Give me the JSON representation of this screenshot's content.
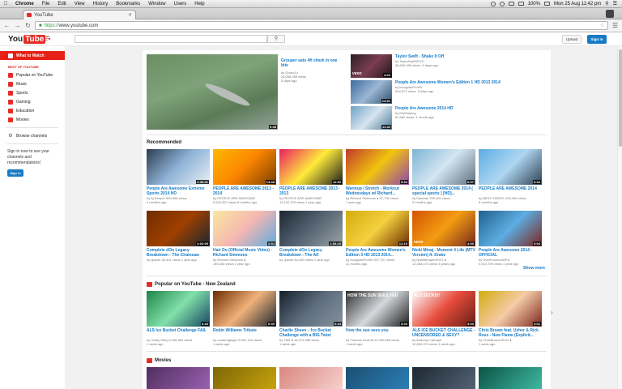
{
  "menubar": {
    "items": [
      "Chrome",
      "File",
      "Edit",
      "View",
      "History",
      "Bookmarks",
      "Window",
      "Users",
      "Help"
    ],
    "battery": "100%",
    "datetime": "Mon 25 Aug 11:42 pm"
  },
  "browser": {
    "tab_title": "YouTube",
    "url_scheme": "https://",
    "url_rest": "www.youtube.com"
  },
  "masthead": {
    "logo_you": "You",
    "logo_tube": "Tube",
    "logo_country": "NZ",
    "upload_label": "Upload",
    "signin_label": "Sign in"
  },
  "sidebar": {
    "what_to_watch": "What to Watch",
    "section_label": "BEST OF YOUTUBE",
    "items": [
      "Popular on YouTube",
      "Music",
      "Sports",
      "Gaming",
      "Education",
      "Movies"
    ],
    "browse_channels": "Browse channels",
    "signin_note": "Sign in now to see your channels and recommendations!",
    "signin_label": "Sign in"
  },
  "featured": {
    "main": {
      "title": "Grouper eats 4ft shark in one bite",
      "channel": "by Gordo14",
      "views": "26,058,998 views",
      "age": "5 days ago",
      "duration": "0:48"
    },
    "side": [
      {
        "title": "Taylor Swift - Shake It Off",
        "channel": "by TaylorSwiftVEVO",
        "views": "36,992,999 views",
        "age": "6 days ago",
        "duration": "4:02",
        "vevo": "vevo"
      },
      {
        "title": "People Are Awesome Women's Edition 1 HD 2013 2014",
        "channel": "by incognitoProHD",
        "views": "544,572 views",
        "age": "5 days ago",
        "duration": "14:51",
        "vevo": ""
      },
      {
        "title": "People Are Awesome 2014 HD",
        "channel": "by DistSniping",
        "views": "62,562 views",
        "age": "1 month ago",
        "duration": "11:42",
        "vevo": ""
      }
    ]
  },
  "recommended": {
    "heading": "Recommended",
    "show_more": "Show more",
    "row1": [
      {
        "title": "People Are Awesome Extreme Sports 2014 HD",
        "meta": "by Aj Deeper  390,058 views",
        "age": "4 months ago",
        "duration": "1:30:01"
      },
      {
        "title": "PEOPLE ARE AWESOME 2013 - 2014",
        "meta": "by PEOPLE ARE AWESOME",
        "age": "5,624,357 views  8 months ago",
        "duration": "14:48"
      },
      {
        "title": "PEOPLE ARE AWESOME 2013 - 2013",
        "meta": "by PEOPLE ARE AWESOME",
        "age": "10,132,378 views  1 year ago",
        "duration": "11:53"
      },
      {
        "title": "Warmup / Stretch - Workout Wednesdays w/ Richard...",
        "meta": "by Richard Simmons ●  57,706 views",
        "age": "1 year ago",
        "duration": "9:34"
      },
      {
        "title": "PEOPLE ARE AWESOME 2014 ( special sports ) [HD]...",
        "meta": "by Kianéan  755,426 views",
        "age": "5 months ago",
        "duration": "6:07"
      },
      {
        "title": "PEOPLE ARE AWESOME 2014",
        "meta": "by BEST VIDEOS  106,185 views",
        "age": "5 months ago",
        "duration": "6:34"
      }
    ],
    "row2": [
      {
        "title": "Complete dOo Legacy Breakdown - The Chainsaw",
        "meta": "by quknet  36,301 views  1 year ago",
        "age": "",
        "duration": "2:02:09",
        "vevo": ""
      },
      {
        "title": "Hair Do (Official Music Video) - Richard Simmons",
        "meta": "by Richard Simmons ●",
        "age": "189,166 views  1 year ago",
        "duration": "3:54",
        "vevo": ""
      },
      {
        "title": "Complete dOo Legacy Breakdown - The AK",
        "meta": "by quknet  54,459 views  1 year ago",
        "age": "",
        "duration": "1:53:29",
        "vevo": ""
      },
      {
        "title": "People Are Awesome Women's Edition 3 HD 2013 2014...",
        "meta": "by incognitoProHD  927,757 views",
        "age": "11 months ago",
        "duration": "12:19",
        "vevo": ""
      },
      {
        "title": "Nicki Minaj - Moment 4 Life (MTV Version) ft. Drake",
        "meta": "by NickiMinajAtVEVO ●",
        "age": "12,383,474 views  3 years ago",
        "duration": "4:50",
        "vevo": "vevo"
      },
      {
        "title": "People Are Awesome 2014 - OFFICIAL",
        "meta": "by OverPoweredGPU",
        "age": "3,914,709 views  1 year ago",
        "duration": "5:04",
        "vevo": ""
      }
    ]
  },
  "popular": {
    "heading": "Popular on YouTube - New Zealand",
    "items": [
      {
        "title": "ALS Ice Bucket Challenge FAIL",
        "meta": "by Grady Riley  6,166,864 views",
        "age": "1 week ago",
        "duration": "0:43"
      },
      {
        "title": "Robin Williams Tribute",
        "meta": "by modernginger  9,657,160 views",
        "age": "1 week ago",
        "duration": "0:30"
      },
      {
        "title": "Charlie Sheen – Ice Bucket Challenge with a BIG Twist",
        "meta": "by TMZ ●  16,279,988 views",
        "age": "1 week ago",
        "duration": "0:34"
      },
      {
        "title": "How the sun sees you",
        "meta": "by Thomas Leveritt  12,280,066 views",
        "age": "1 week ago",
        "duration": "3:03"
      },
      {
        "title": "ALS ICE BUCKET CHALLENGE - UNCENSORED & SEXY?",
        "meta": "by Anthony Carbajal",
        "age": "12,554,374 views  1 week ago",
        "duration": "5:03"
      },
      {
        "title": "Chris Brown feat. Usher & Rick Ross - New Flame (Explicit...",
        "meta": "by ChrisBrownVEVO ●",
        "age": "1 week ago",
        "duration": "4:01"
      }
    ],
    "thumb_caption_sun": "HOW THE SUN SEES YOU",
    "thumb_caption_als": "ALS SUCKS!!"
  },
  "movies": {
    "heading": "Movies"
  }
}
